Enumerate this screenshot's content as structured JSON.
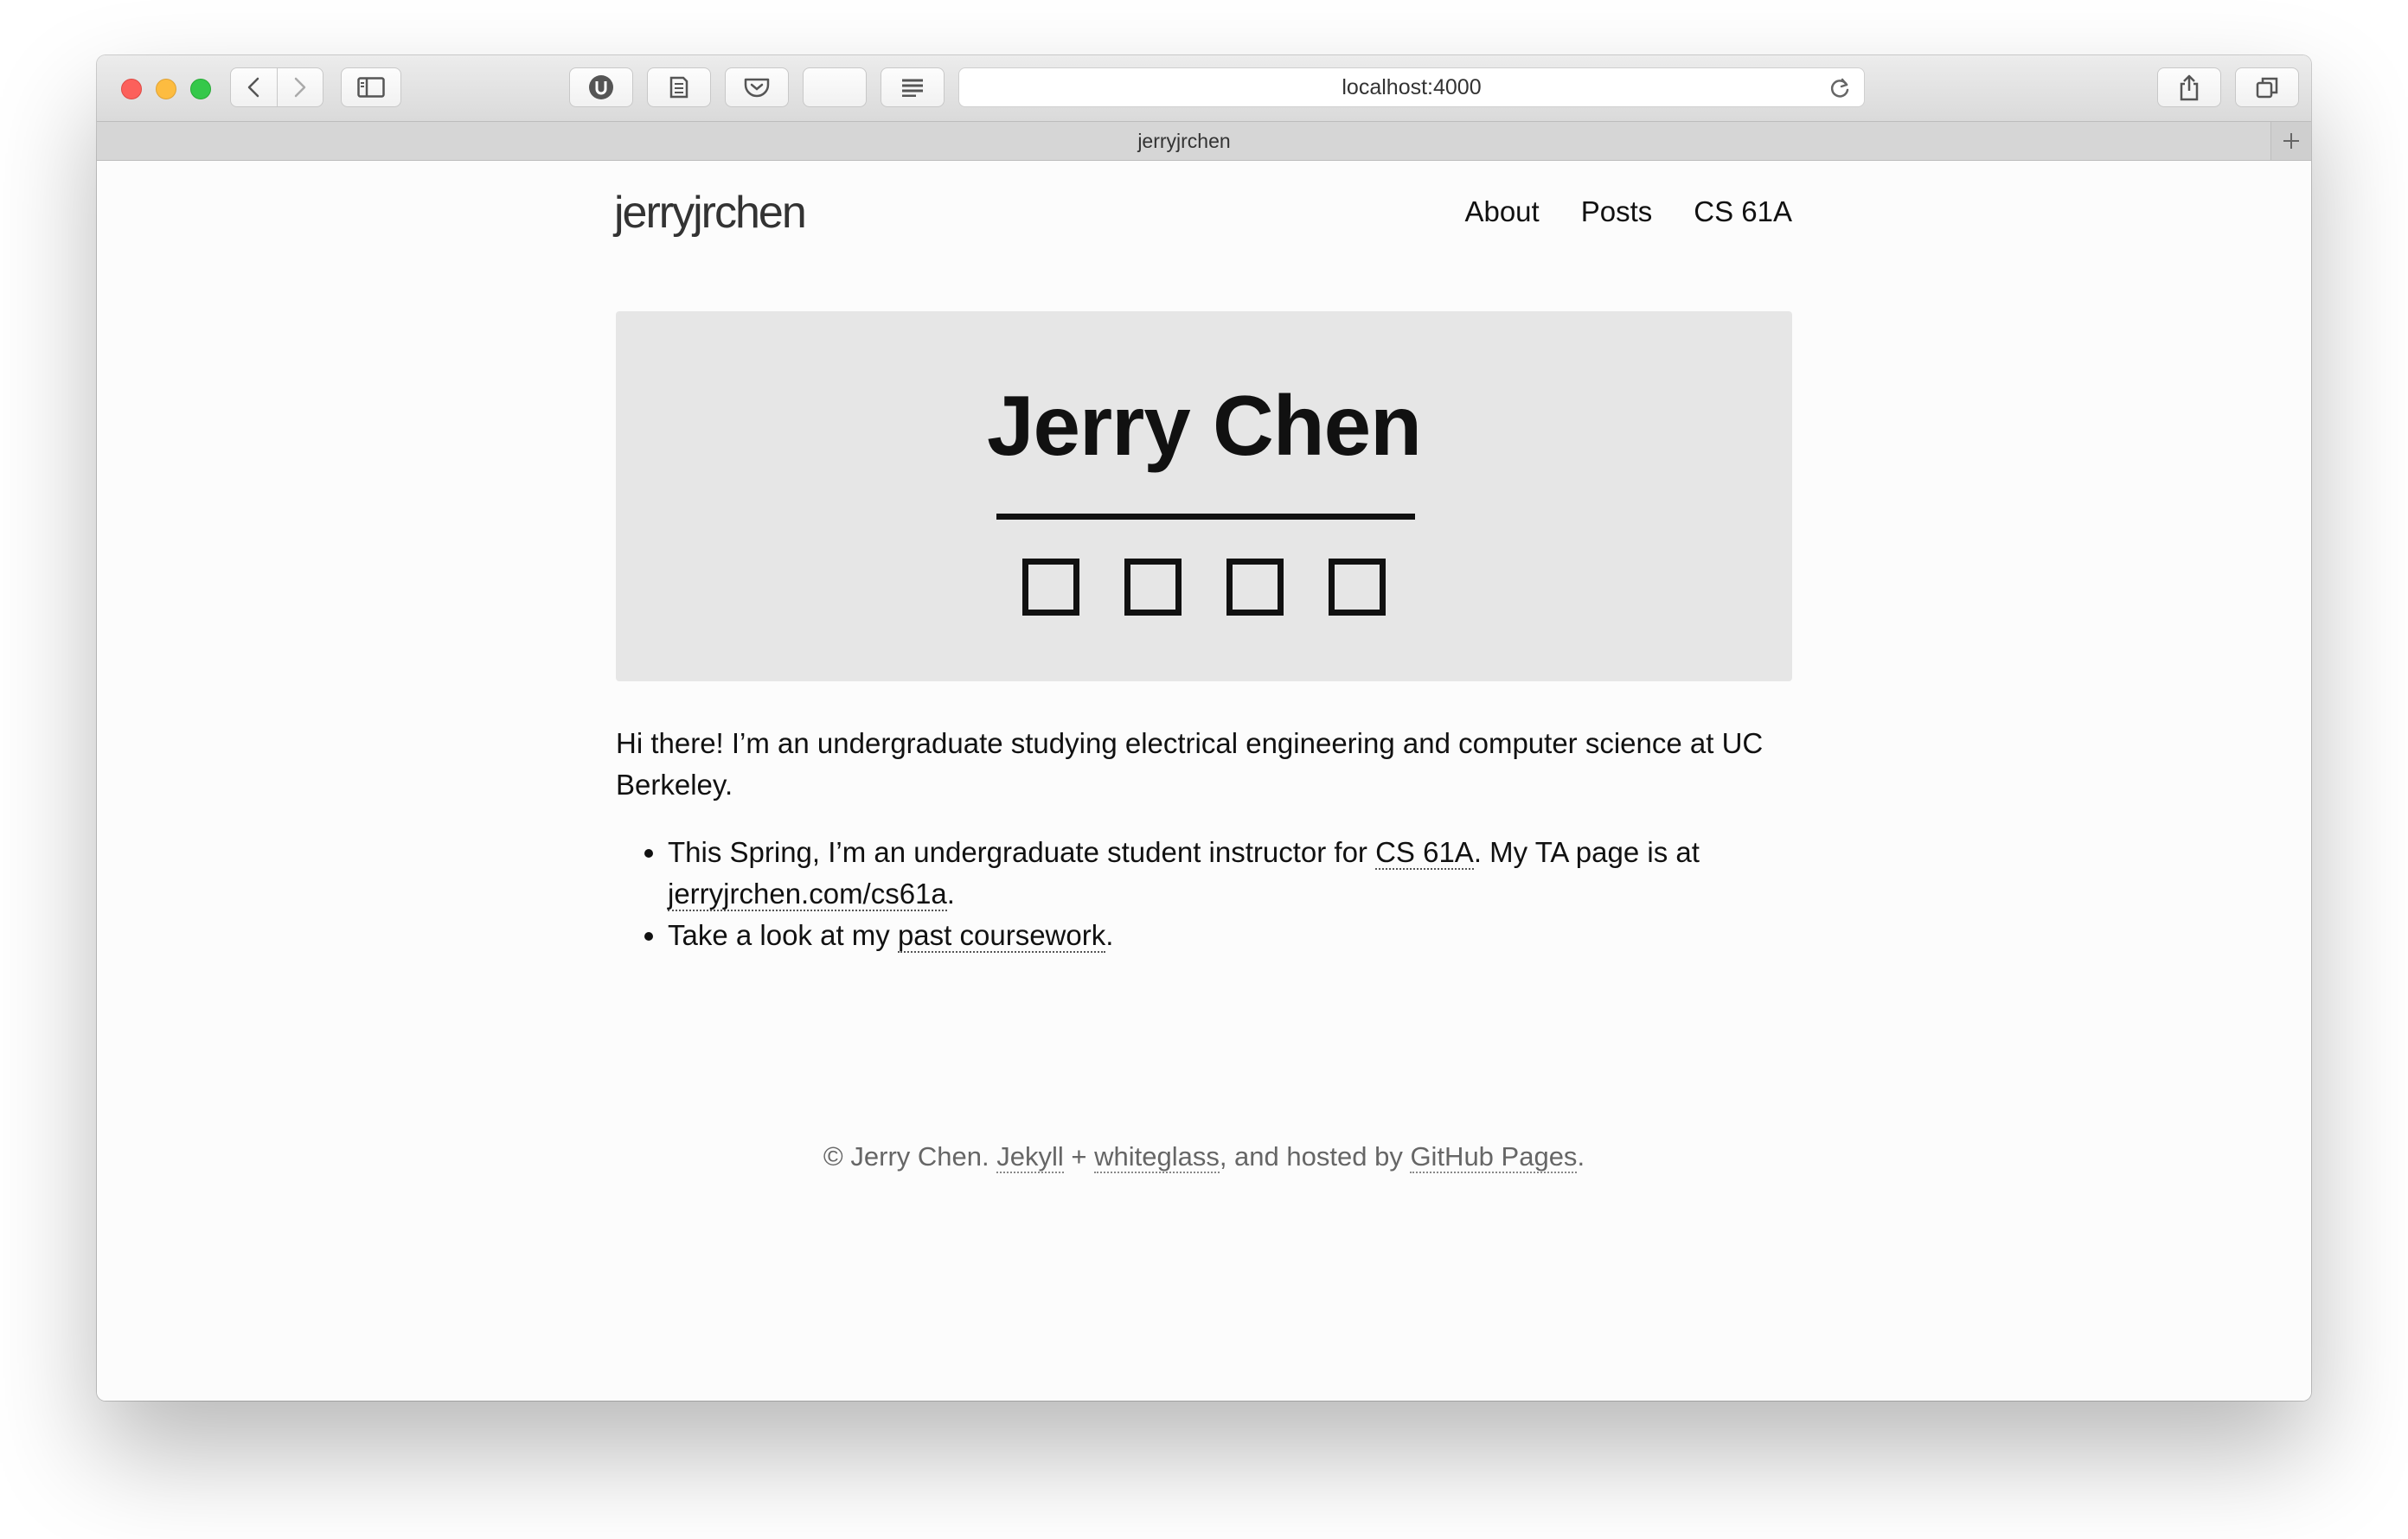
{
  "browser": {
    "url": "localhost:4000",
    "tab_title": "jerryjrchen"
  },
  "site": {
    "title": "jerryjrchen",
    "nav": [
      "About",
      "Posts",
      "CS 61A"
    ]
  },
  "hero": {
    "name": "Jerry Chen",
    "icon_count": 4
  },
  "content": {
    "intro": "Hi there! I’m an undergraduate studying electrical engineering and computer science at UC Berkeley.",
    "bullet1": {
      "before": "This Spring, I’m an undergraduate student instructor for ",
      "link1": "CS 61A",
      "middle": ". My TA page is at ",
      "link2": "jerryjrchen.com/cs61a",
      "after": "."
    },
    "bullet2": {
      "before": "Take a look at my ",
      "link": "past coursework",
      "after": "."
    }
  },
  "footer": {
    "copyright": "© Jerry Chen. ",
    "jekyll": "Jekyll",
    "plus": " + ",
    "whiteglass": "whiteglass",
    "hosted": ", and hosted by ",
    "github": "GitHub Pages",
    "end": "."
  }
}
